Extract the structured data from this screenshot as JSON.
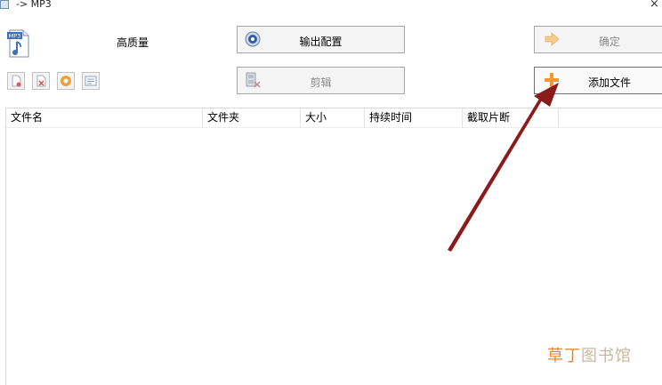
{
  "window": {
    "title": "-> MP3",
    "close_glyph": "×",
    "icon": "app-icon"
  },
  "format": {
    "icon": "mp3-file-icon",
    "icon_text": "MP3",
    "quality": "高质量"
  },
  "buttons": {
    "output_settings": {
      "label": "输出配置",
      "icon": "gear-disc-icon"
    },
    "edit": {
      "label": "剪辑",
      "icon": "film-edit-icon"
    },
    "confirm": {
      "label": "确定",
      "icon": "arrow-right-icon"
    },
    "add_file": {
      "label": "添加文件",
      "icon": "plus-icon"
    }
  },
  "toolbar": {
    "items": [
      {
        "name": "remove-file-icon"
      },
      {
        "name": "clear-list-icon"
      },
      {
        "name": "play-icon"
      },
      {
        "name": "media-info-icon"
      }
    ]
  },
  "file_list": {
    "columns": [
      "文件名",
      "文件夹",
      "大小",
      "持续时间",
      "截取片断"
    ],
    "rows": []
  },
  "watermark": {
    "brand": "草丁",
    "text": "图书馆"
  },
  "colors": {
    "accent_orange": "#f39a2b",
    "arrow": "#8b1a1a",
    "border": "#a6a6a6"
  }
}
